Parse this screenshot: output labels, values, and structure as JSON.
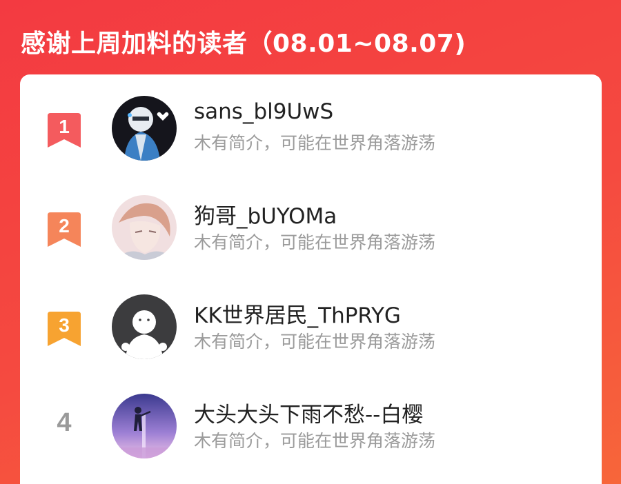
{
  "header": {
    "title": "感谢上周加料的读者（08.01~08.07)"
  },
  "readers": [
    {
      "rank": "1",
      "name": "sans_bl9UwS",
      "bio": "木有简介，可能在世界角落游荡",
      "badge_color": "#f45b5e"
    },
    {
      "rank": "2",
      "name": "狗哥_bUYOMa",
      "bio": "木有简介，可能在世界角落游荡",
      "badge_color": "#f5855a"
    },
    {
      "rank": "3",
      "name": "KK世界居民_ThPRYG",
      "bio": "木有简介，可能在世界角落游荡",
      "badge_color": "#f7a331"
    },
    {
      "rank": "4",
      "name": "大头大头下雨不愁--白樱",
      "bio": "木有简介，可能在世界角落游荡"
    }
  ],
  "colors": {
    "background_top": "#f33a41",
    "background_bottom": "#f7663a",
    "card": "#ffffff",
    "name_text": "#222222",
    "bio_text": "#9b9b9b",
    "plain_rank": "#9a9a9a"
  }
}
